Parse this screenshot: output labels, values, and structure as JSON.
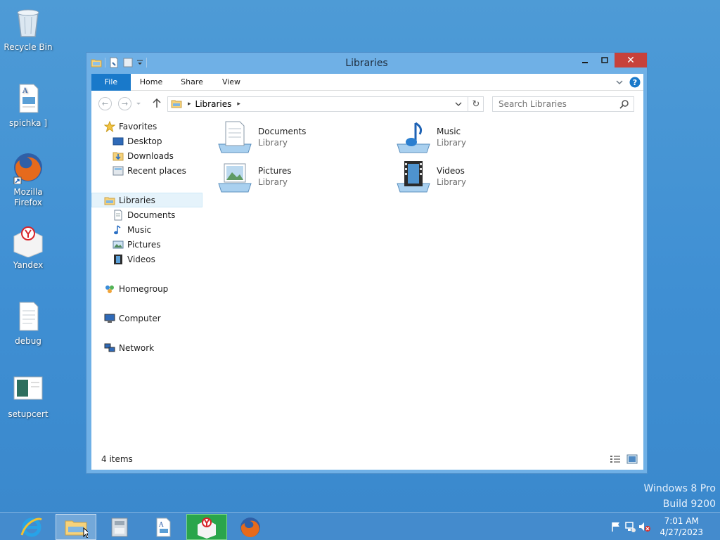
{
  "desktop": {
    "icons": [
      {
        "label": "Recycle Bin"
      },
      {
        "label": "spichka ]"
      },
      {
        "label": "Mozilla Firefox"
      },
      {
        "label": "Yandex"
      },
      {
        "label": "debug"
      },
      {
        "label": "setupcert"
      }
    ],
    "watermark": {
      "line1": "Windows 8 Pro",
      "line2": "Build 9200"
    }
  },
  "window": {
    "title": "Libraries",
    "ribbon": {
      "tabs": [
        "File",
        "Home",
        "Share",
        "View"
      ]
    },
    "address": {
      "crumb": "Libraries",
      "search_placeholder": "Search Libraries"
    },
    "nav": {
      "favorites": "Favorites",
      "desktop": "Desktop",
      "downloads": "Downloads",
      "recent": "Recent places",
      "libraries": "Libraries",
      "documents": "Documents",
      "music": "Music",
      "pictures": "Pictures",
      "videos": "Videos",
      "homegroup": "Homegroup",
      "computer": "Computer",
      "network": "Network"
    },
    "items": [
      {
        "name": "Documents",
        "type": "Library"
      },
      {
        "name": "Music",
        "type": "Library"
      },
      {
        "name": "Pictures",
        "type": "Library"
      },
      {
        "name": "Videos",
        "type": "Library"
      }
    ],
    "status": {
      "count": "4 items"
    }
  },
  "taskbar": {
    "clock": {
      "time": "7:01 AM",
      "date": "4/27/2023"
    }
  }
}
